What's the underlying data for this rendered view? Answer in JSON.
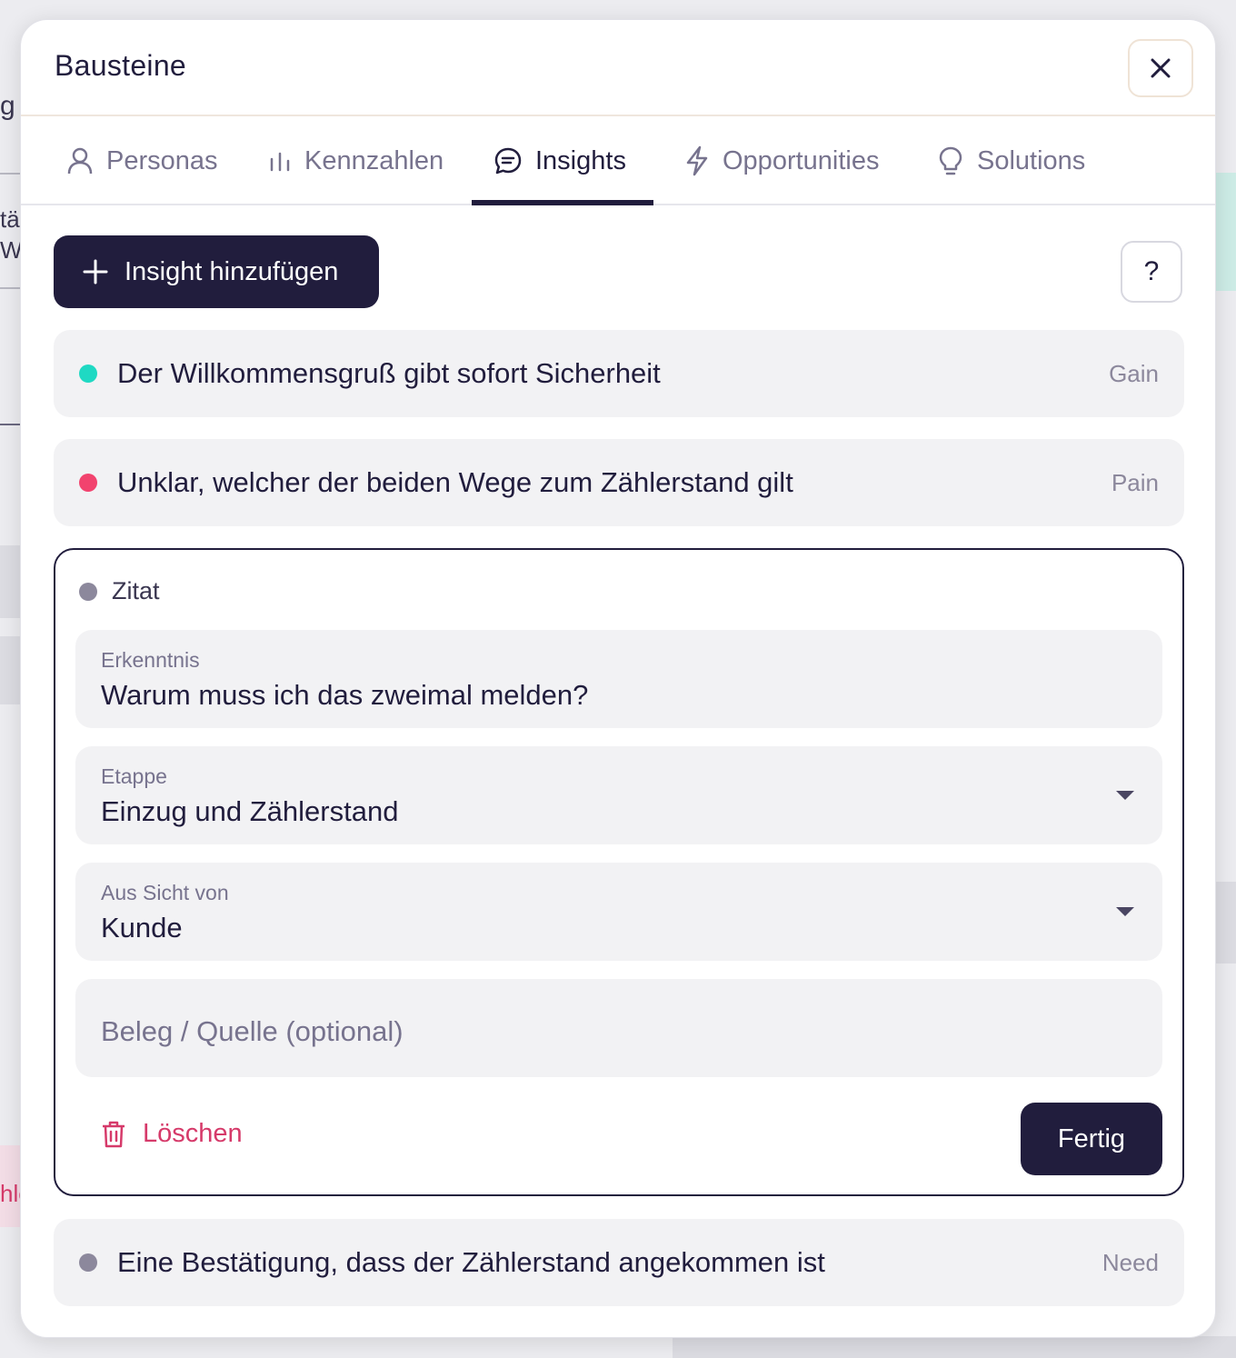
{
  "background": {
    "fragment_1": "g",
    "fragment_2": "täl",
    "fragment_3": "W",
    "fragment_4": "hle"
  },
  "modal": {
    "title": "Bausteine"
  },
  "tabs": [
    {
      "label": "Personas",
      "icon": "person-icon",
      "active": false
    },
    {
      "label": "Kennzahlen",
      "icon": "bar-chart-icon",
      "active": false
    },
    {
      "label": "Insights",
      "icon": "chat-bubble-icon",
      "active": true
    },
    {
      "label": "Opportunities",
      "icon": "lightning-icon",
      "active": false
    },
    {
      "label": "Solutions",
      "icon": "lightbulb-icon",
      "active": false
    }
  ],
  "toolbar": {
    "add_label": "Insight hinzufügen",
    "help_label": "?"
  },
  "insights": [
    {
      "text": "Der Willkommensgruß gibt sofort Sicherheit",
      "tag": "Gain",
      "color": "#1fd9c3"
    },
    {
      "text": "Unklar, welcher der beiden Wege zum Zählerstand gilt",
      "tag": "Pain",
      "color": "#f2436e"
    },
    {
      "text": "Eine Bestätigung, dass der Zählerstand angekommen ist",
      "tag": "Need",
      "color": "#8c889c"
    }
  ],
  "editor": {
    "type": "Zitat",
    "type_color": "#8c889c",
    "erkenntnis_label": "Erkenntnis",
    "erkenntnis_value": "Warum muss ich das zweimal melden?",
    "etappe_label": "Etappe",
    "etappe_value": "Einzug und Zählerstand",
    "sicht_label": "Aus Sicht von",
    "sicht_value": "Kunde",
    "beleg_placeholder": "Beleg / Quelle (optional)",
    "delete_label": "Löschen",
    "done_label": "Fertig"
  },
  "colors": {
    "primary": "#211d3d",
    "danger": "#d63a6a",
    "gain": "#1fd9c3",
    "pain": "#f2436e"
  }
}
